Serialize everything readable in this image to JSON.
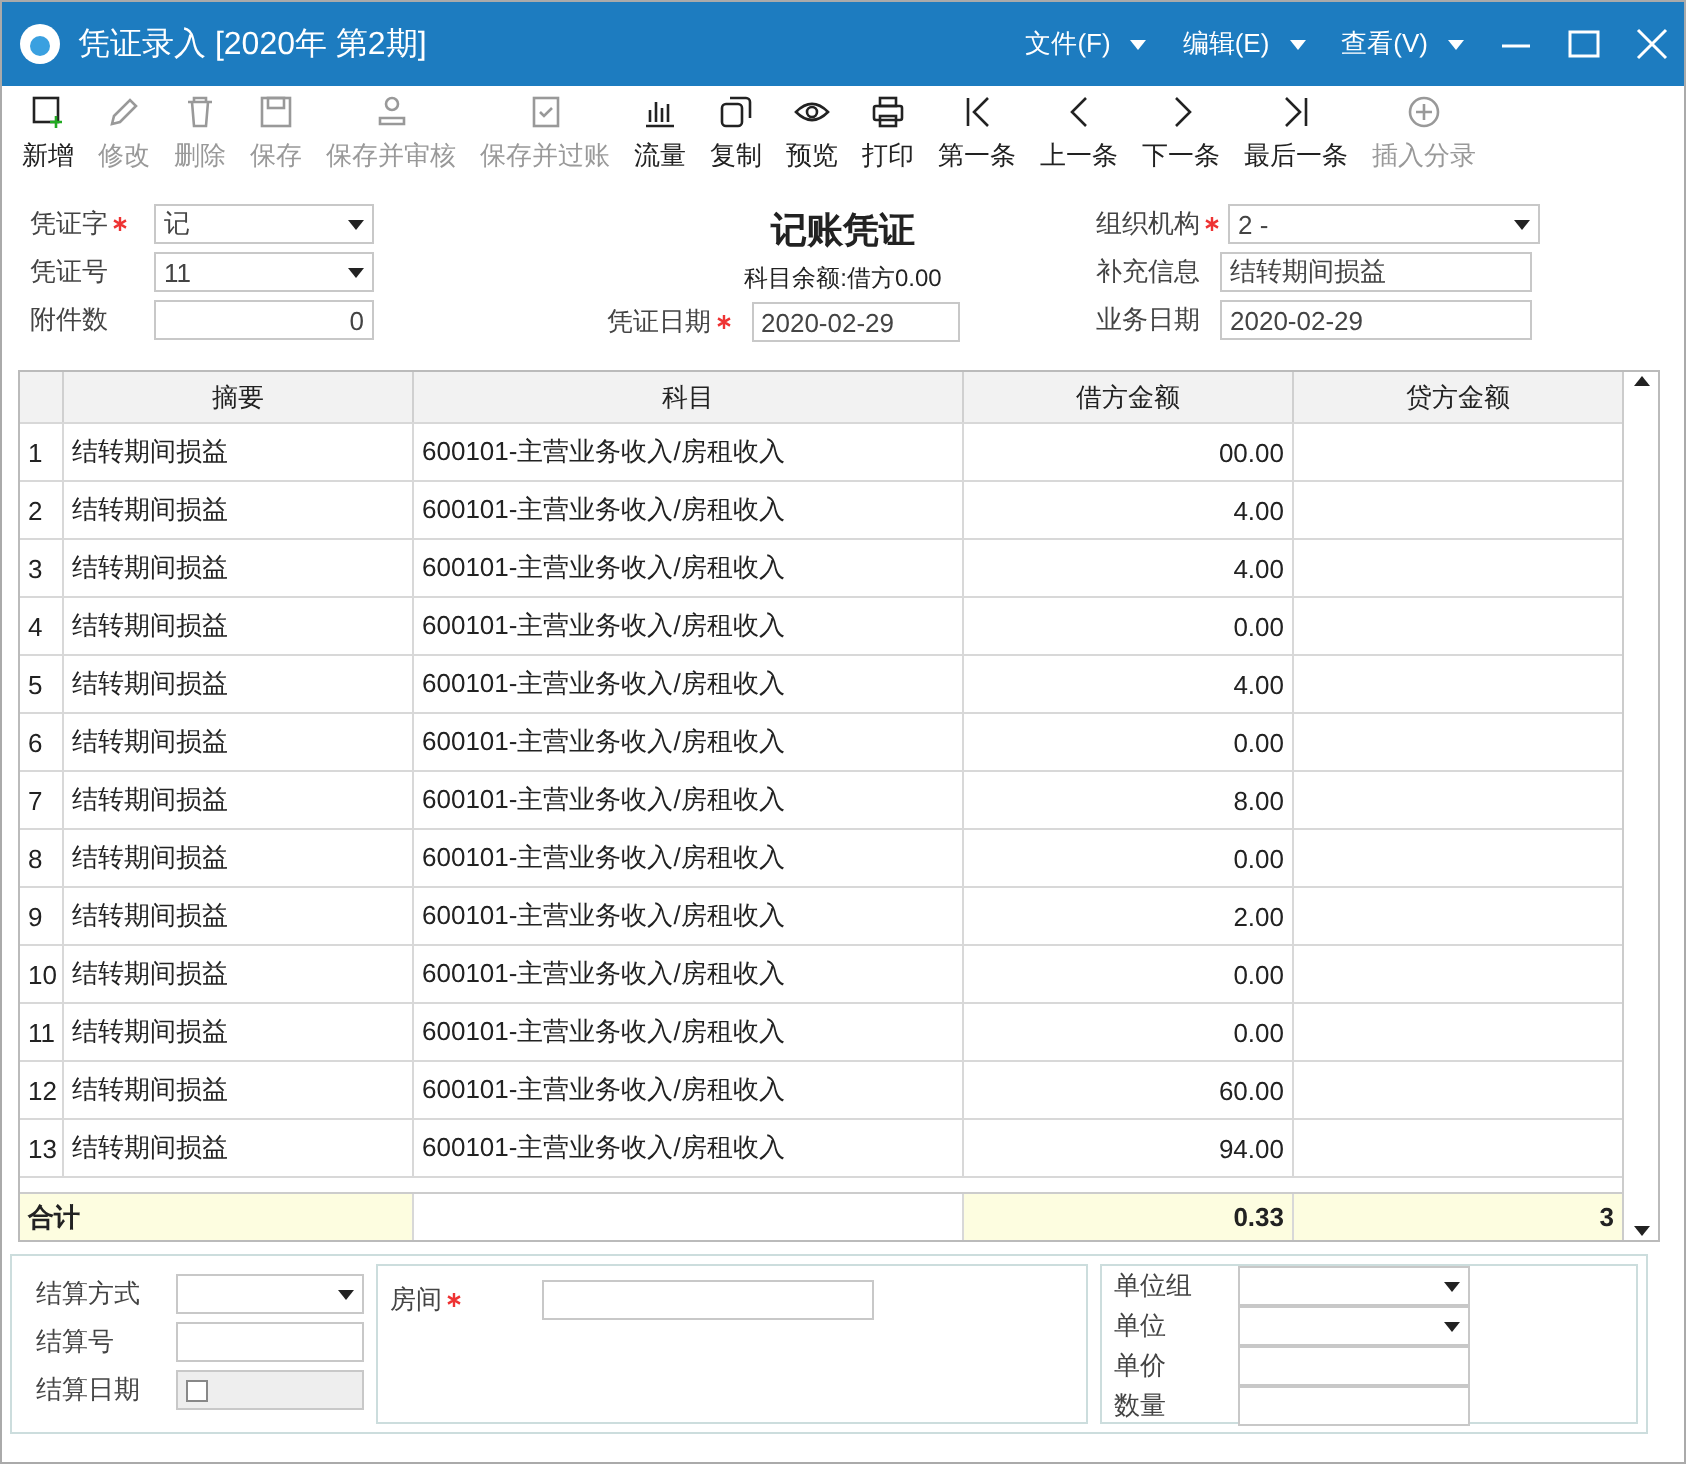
{
  "window": {
    "title": "凭证录入 [2020年 第2期]",
    "menus": [
      "文件(F)",
      "编辑(E)",
      "查看(V)"
    ]
  },
  "toolbar": [
    {
      "label": "新增",
      "kind": "add",
      "disabled": false
    },
    {
      "label": "修改",
      "kind": "edit",
      "disabled": true
    },
    {
      "label": "删除",
      "kind": "trash",
      "disabled": true
    },
    {
      "label": "保存",
      "kind": "save",
      "disabled": true
    },
    {
      "label": "保存并审核",
      "kind": "stamp",
      "disabled": true
    },
    {
      "label": "保存并过账",
      "kind": "check",
      "disabled": true
    },
    {
      "label": "流量",
      "kind": "chart",
      "disabled": false
    },
    {
      "label": "复制",
      "kind": "copy",
      "disabled": false
    },
    {
      "label": "预览",
      "kind": "eye",
      "disabled": false
    },
    {
      "label": "打印",
      "kind": "printer",
      "disabled": false
    },
    {
      "label": "第一条",
      "kind": "first",
      "disabled": false
    },
    {
      "label": "上一条",
      "kind": "prev",
      "disabled": false
    },
    {
      "label": "下一条",
      "kind": "next",
      "disabled": false
    },
    {
      "label": "最后一条",
      "kind": "last",
      "disabled": false
    },
    {
      "label": "插入分录",
      "kind": "plus",
      "disabled": true
    }
  ],
  "header": {
    "title": "记账凭证",
    "balance": "科目余额:借方0.00",
    "voucher_word": {
      "label": "凭证字",
      "value": "记",
      "required": true
    },
    "voucher_no": {
      "label": "凭证号",
      "value": "11"
    },
    "attachments": {
      "label": "附件数",
      "value": "0"
    },
    "voucher_date": {
      "label": "凭证日期",
      "value": "2020-02-29",
      "required": true
    },
    "org": {
      "label": "组织机构",
      "value": "2 - ",
      "required": true
    },
    "extra": {
      "label": "补充信息",
      "value": "结转期间损益"
    },
    "business_date": {
      "label": "业务日期",
      "value": "2020-02-29"
    }
  },
  "table": {
    "columns": [
      "摘要",
      "科目",
      "借方金额",
      "贷方金额"
    ],
    "rows": [
      {
        "no": "1",
        "summary": "结转期间损益",
        "account": "600101-主营业务收入/房租收入",
        "debit": "00.00"
      },
      {
        "no": "2",
        "summary": "结转期间损益",
        "account": "600101-主营业务收入/房租收入",
        "debit": "4.00"
      },
      {
        "no": "3",
        "summary": "结转期间损益",
        "account": "600101-主营业务收入/房租收入",
        "debit": "4.00"
      },
      {
        "no": "4",
        "summary": "结转期间损益",
        "account": "600101-主营业务收入/房租收入",
        "debit": "0.00"
      },
      {
        "no": "5",
        "summary": "结转期间损益",
        "account": "600101-主营业务收入/房租收入",
        "debit": "4.00"
      },
      {
        "no": "6",
        "summary": "结转期间损益",
        "account": "600101-主营业务收入/房租收入",
        "debit": "0.00"
      },
      {
        "no": "7",
        "summary": "结转期间损益",
        "account": "600101-主营业务收入/房租收入",
        "debit": "8.00"
      },
      {
        "no": "8",
        "summary": "结转期间损益",
        "account": "600101-主营业务收入/房租收入",
        "debit": "0.00"
      },
      {
        "no": "9",
        "summary": "结转期间损益",
        "account": "600101-主营业务收入/房租收入",
        "debit": "2.00"
      },
      {
        "no": "10",
        "summary": "结转期间损益",
        "account": "600101-主营业务收入/房租收入",
        "debit": "0.00"
      },
      {
        "no": "11",
        "summary": "结转期间损益",
        "account": "600101-主营业务收入/房租收入",
        "debit": "0.00"
      },
      {
        "no": "12",
        "summary": "结转期间损益",
        "account": "600101-主营业务收入/房租收入",
        "debit": "60.00"
      },
      {
        "no": "13",
        "summary": "结转期间损益",
        "account": "600101-主营业务收入/房租收入",
        "debit": "94.00"
      }
    ],
    "total": {
      "label": "合计",
      "debit": "0.33",
      "credit": "3"
    }
  },
  "settlement": {
    "method_label": "结算方式",
    "number_label": "结算号",
    "date_label": "结算日期"
  },
  "room": {
    "label": "房间",
    "required": true
  },
  "units": {
    "group_label": "单位组",
    "unit_label": "单位",
    "price_label": "单价",
    "qty_label": "数量"
  }
}
